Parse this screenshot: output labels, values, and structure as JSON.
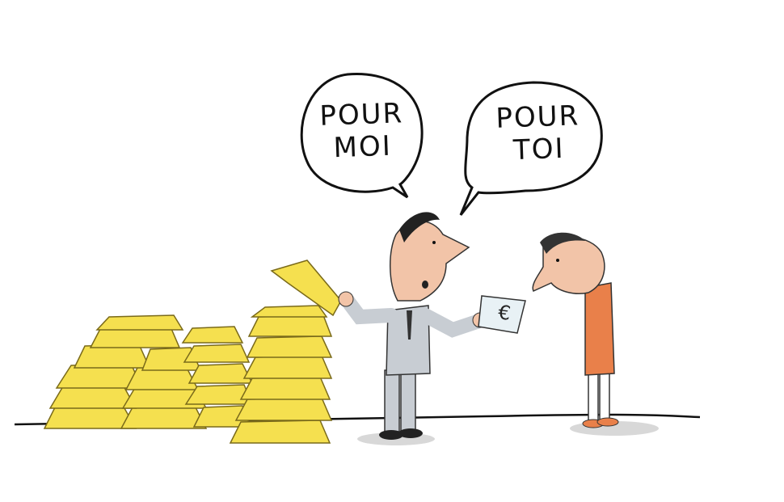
{
  "speech_bubbles": {
    "left": {
      "lines": [
        "POUR",
        "MOI"
      ]
    },
    "right": {
      "lines": [
        "POUR",
        "TOI"
      ]
    }
  },
  "banknote": {
    "symbol": "€"
  },
  "colors": {
    "gold": "#f5e04f",
    "gold_shadow": "#e6cd35",
    "skin": "#f2c4a8",
    "suit": "#c8cdd3",
    "orange_sweater": "#e9804a",
    "ink": "#111111",
    "note": "#e8f1f5"
  }
}
